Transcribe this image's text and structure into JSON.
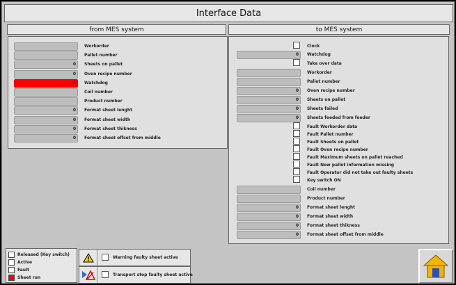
{
  "title": "Interface Data",
  "from_section": {
    "header": "from MES system",
    "rows": [
      {
        "label": "Workorder",
        "value": "",
        "red": false
      },
      {
        "label": "Pallet number",
        "value": "",
        "red": false
      },
      {
        "label": "Sheets on pallet",
        "value": "0",
        "red": false
      },
      {
        "label": "Oven recipe number",
        "value": "0",
        "red": false
      },
      {
        "label": "Watchdog",
        "value": "0",
        "red": true
      },
      {
        "label": "Coil number",
        "value": "",
        "red": false
      },
      {
        "label": "Product number",
        "value": "",
        "red": false
      },
      {
        "label": "Format sheet lenght",
        "value": "0",
        "red": false
      },
      {
        "label": "Format sheet width",
        "value": "0",
        "red": false
      },
      {
        "label": "Format sheet thikness",
        "value": "0",
        "red": false
      },
      {
        "label": "Format sheet offset from middle",
        "value": "0",
        "red": false
      }
    ]
  },
  "to_section": {
    "header": "to MES system",
    "rows": [
      {
        "kind": "checkbox",
        "label": "Clock"
      },
      {
        "kind": "field",
        "label": "Watchdog",
        "value": "0"
      },
      {
        "kind": "checkbox",
        "label": "Take over data"
      },
      {
        "kind": "field",
        "label": "Workorder",
        "value": ""
      },
      {
        "kind": "field",
        "label": "Pallet number",
        "value": ""
      },
      {
        "kind": "field",
        "label": "Oven recipe number",
        "value": "0"
      },
      {
        "kind": "field",
        "label": "Sheets on pallet",
        "value": "0"
      },
      {
        "kind": "field",
        "label": "Sheets failed",
        "value": "0"
      },
      {
        "kind": "field",
        "label": "Sheets feeded from feeder",
        "value": "0"
      },
      {
        "kind": "checkbox",
        "label": "Fault Workorder data"
      },
      {
        "kind": "checkbox",
        "label": "Fault Pallet number"
      },
      {
        "kind": "checkbox",
        "label": "Fault Sheets on pallet"
      },
      {
        "kind": "checkbox",
        "label": "Fault Oven recipe number"
      },
      {
        "kind": "checkbox",
        "label": "Fault Maximum sheets on pallet reached"
      },
      {
        "kind": "checkbox",
        "label": "Fault New pallet information missing"
      },
      {
        "kind": "checkbox",
        "label": "Fault Operator did not take out faulty sheets"
      },
      {
        "kind": "checkbox",
        "label": "Key switch ON"
      },
      {
        "kind": "field",
        "label": "Coil number",
        "value": ""
      },
      {
        "kind": "field",
        "label": "Product number",
        "value": ""
      },
      {
        "kind": "field",
        "label": "Format sheet lenght",
        "value": "0"
      },
      {
        "kind": "field",
        "label": "Format sheet width",
        "value": "0"
      },
      {
        "kind": "field",
        "label": "Format sheet thikness",
        "value": "0"
      },
      {
        "kind": "field",
        "label": "Format sheet offset from middle",
        "value": "0"
      }
    ]
  },
  "legend": [
    {
      "label": "Released (Key switch)",
      "red": false
    },
    {
      "label": "Active",
      "red": false
    },
    {
      "label": "Fault",
      "red": false
    },
    {
      "label": "Sheet run",
      "red": true
    }
  ],
  "warnings": [
    {
      "icon": "warning-triangle-icon",
      "label": "Warning faulty sheet active"
    },
    {
      "icon": "transport-stop-icon",
      "label": "Transport stop faulty sheet active"
    }
  ],
  "home": {
    "icon": "home-icon"
  }
}
